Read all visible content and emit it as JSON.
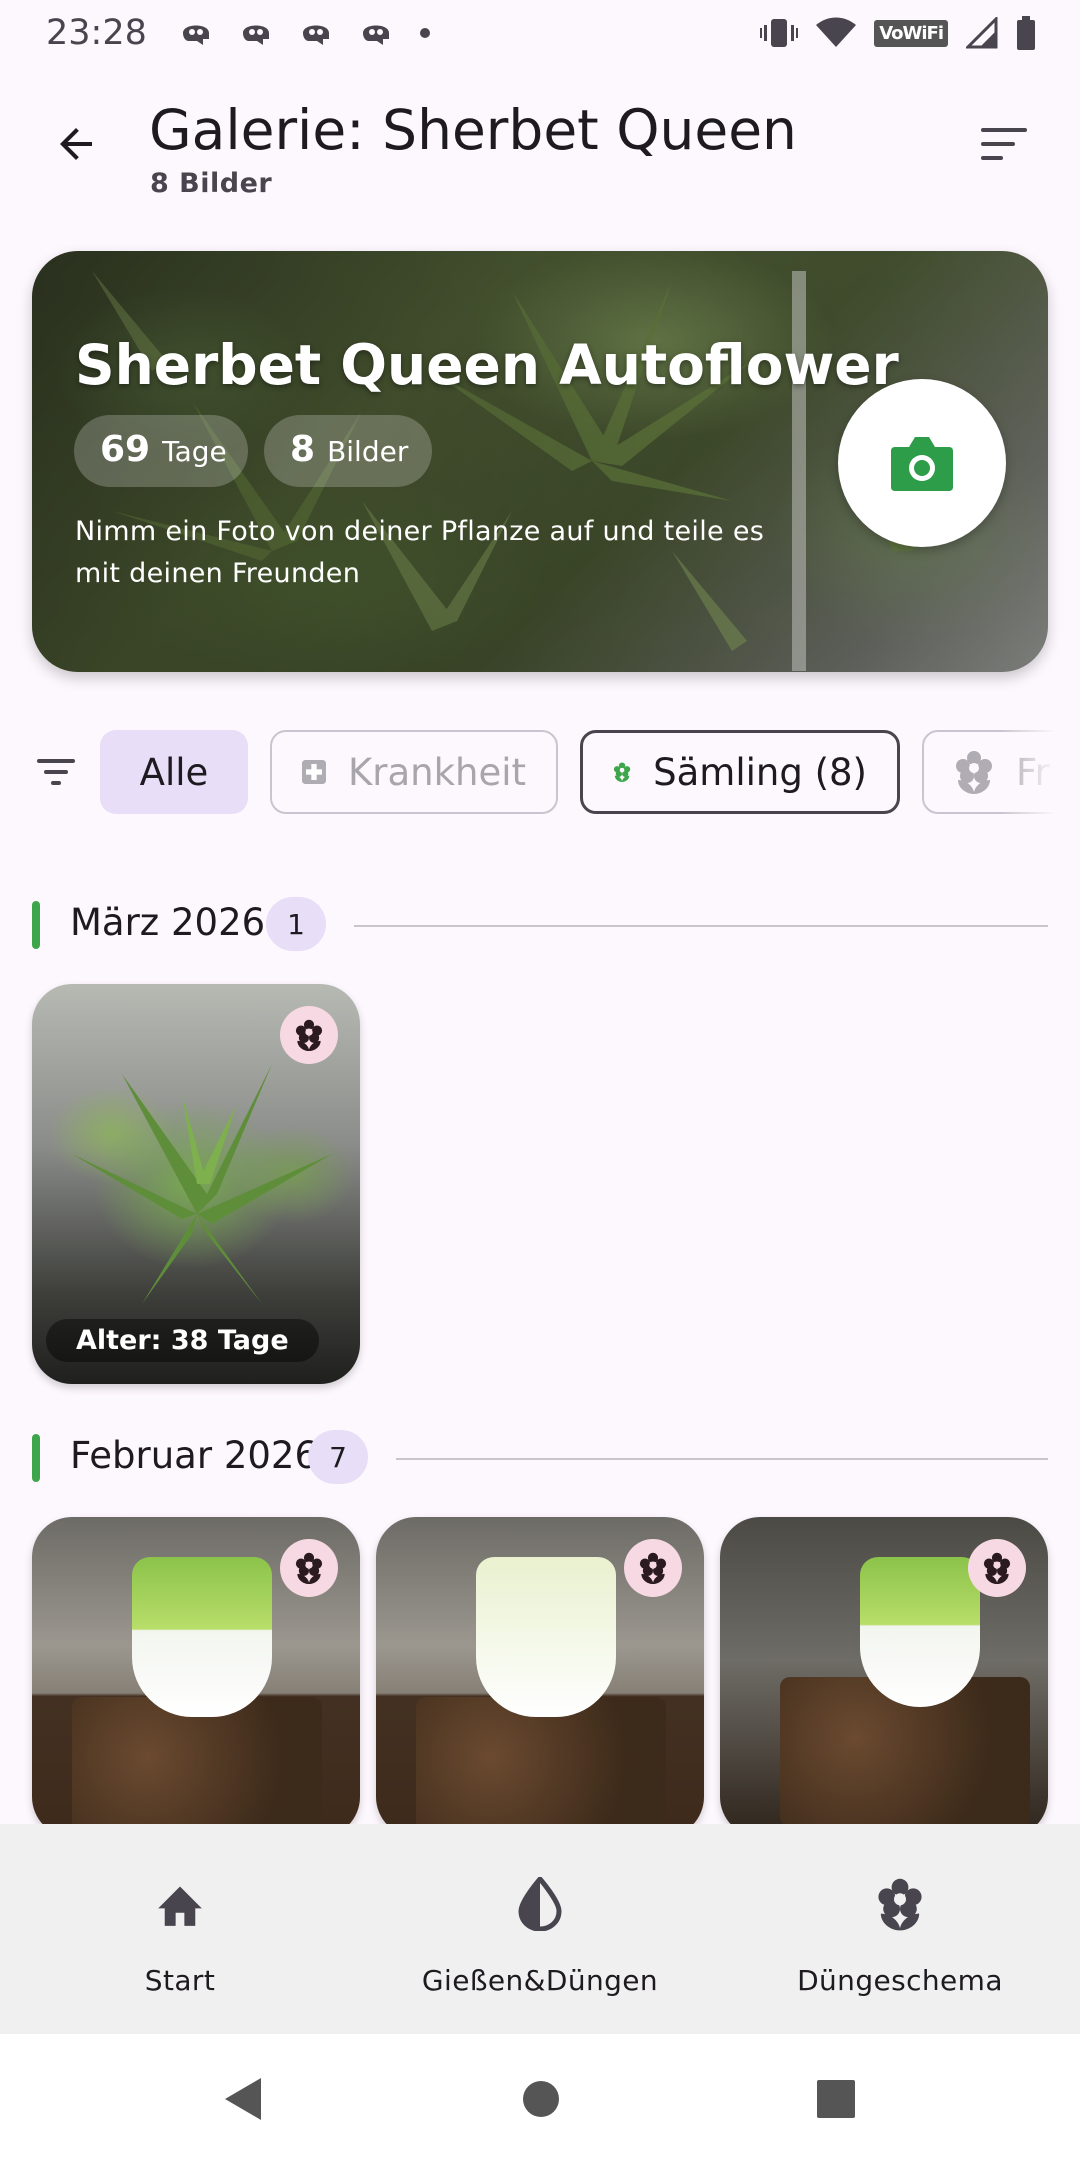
{
  "status": {
    "time": "23:28",
    "wifi_label": "VoWiFi"
  },
  "header": {
    "title": "Galerie: Sherbet Queen",
    "subtitle": "8 Bilder"
  },
  "hero": {
    "title": "Sherbet Queen Autoflower",
    "days_value": "69",
    "days_label": "Tage",
    "images_value": "8",
    "images_label": "Bilder",
    "description": "Nimm ein Foto von deiner Pflanze auf und teile es mit deinen Freunden",
    "camera_color": "#2e9d4a"
  },
  "filters": {
    "chips": [
      {
        "label": "Alle",
        "selected": true
      },
      {
        "label": "Krankheit",
        "enabled": false
      },
      {
        "label": "Sämling (8)",
        "selected": false
      },
      {
        "label": "Fr",
        "enabled": false
      }
    ]
  },
  "sections": [
    {
      "label": "März 2026",
      "count": "1",
      "photos": [
        {
          "caption": "Alter: 38 Tage"
        }
      ]
    },
    {
      "label": "Februar 2026",
      "count": "7",
      "photos": [
        {},
        {},
        {}
      ]
    }
  ],
  "bottom_nav": {
    "items": [
      {
        "label": "Start",
        "icon": "home-icon"
      },
      {
        "label": "Gießen&Düngen",
        "icon": "water-drop-icon"
      },
      {
        "label": "Düngeschema",
        "icon": "flower-icon"
      }
    ]
  },
  "colors": {
    "accent_green": "#3ea64a",
    "chip_selected": "#e8def8",
    "badge_pink": "#f7d9e3",
    "background": "#fdf7fe"
  }
}
